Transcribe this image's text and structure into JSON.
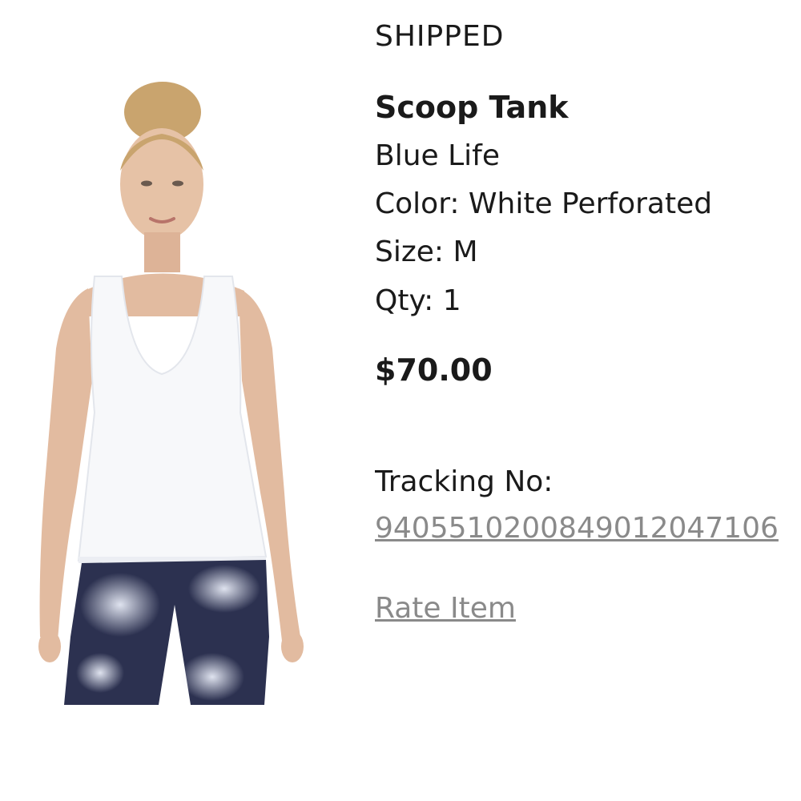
{
  "order_item": {
    "status": "SHIPPED",
    "name": "Scoop Tank",
    "brand": "Blue Life",
    "color": "Color: White Perforated",
    "size": "Size: M",
    "qty": "Qty: 1",
    "price": "$70.00",
    "tracking_label": "Tracking No:",
    "tracking_number": "9405510200849012047106",
    "rate_label": "Rate Item"
  },
  "image": {
    "icon": "product-photo",
    "colors": {
      "tank": "#f7f8fa",
      "skin": "#e2bba0",
      "hair": "#c9a46e",
      "leggings": "#2c3150"
    }
  }
}
